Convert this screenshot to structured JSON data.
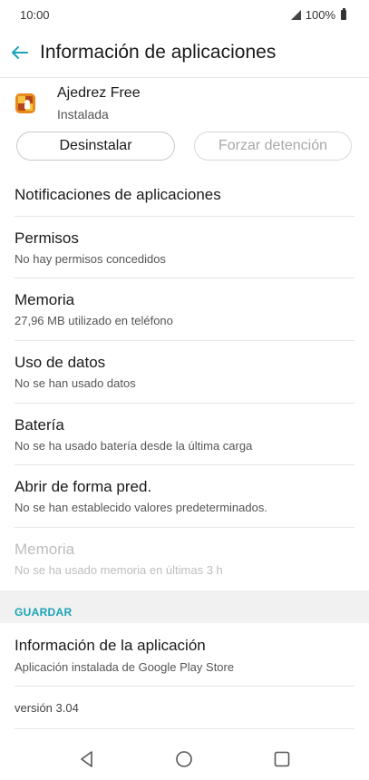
{
  "status_bar": {
    "time": "10:00",
    "battery": "100%"
  },
  "app_bar": {
    "title": "Información de aplicaciones"
  },
  "app": {
    "name": "Ajedrez Free",
    "status": "Instalada"
  },
  "buttons": {
    "uninstall": "Desinstalar",
    "force_stop": "Forzar detención"
  },
  "rows": {
    "notifications": {
      "title": "Notificaciones de aplicaciones"
    },
    "permissions": {
      "title": "Permisos",
      "subtitle": "No hay permisos concedidos"
    },
    "storage": {
      "title": "Memoria",
      "subtitle": "27,96 MB utilizado en teléfono"
    },
    "data_usage": {
      "title": "Uso de datos",
      "subtitle": "No se han usado datos"
    },
    "battery": {
      "title": "Batería",
      "subtitle": "No se ha usado batería desde la última carga"
    },
    "open_default": {
      "title": "Abrir de forma pred.",
      "subtitle": "No se han establecido valores predeterminados."
    },
    "memory": {
      "title": "Memoria",
      "subtitle": "No se ha usado memoria en últimas 3 h"
    }
  },
  "store_section": {
    "header": "GUARDAR",
    "app_info": {
      "title": "Información de la aplicación",
      "subtitle": "Aplicación instalada de Google Play Store"
    }
  },
  "version": "versión 3.04",
  "colors": {
    "accent": "#1aa3b8",
    "disabled_text": "#bdbdbd"
  },
  "icons": {
    "back": "arrow-left-icon",
    "app": "chess-app-icon",
    "nav_back": "triangle-back-icon",
    "nav_home": "circle-home-icon",
    "nav_recents": "square-recents-icon"
  }
}
